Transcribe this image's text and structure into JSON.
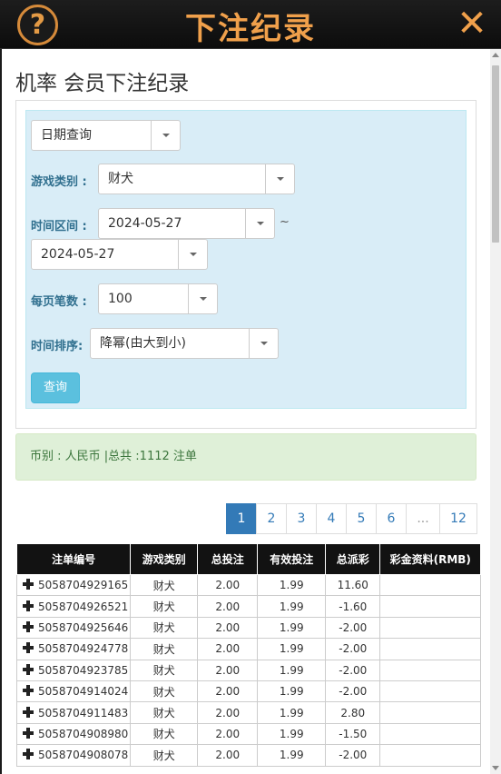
{
  "header": {
    "title": "下注纪录",
    "help_glyph": "?",
    "close_glyph": "✕"
  },
  "page_title": "机率 会员下注纪录",
  "filters": {
    "query_mode": "日期查询",
    "game_type_label": "游戏类别 :",
    "game_type_value": "财犬",
    "time_range_label": "时间区间 :",
    "date_start": "2024-05-27",
    "range_separator": "~",
    "date_end": "2024-05-27",
    "per_page_label": "每页笔数 :",
    "per_page_value": "100",
    "sort_label": "时间排序:",
    "sort_value": "降幂(由大到小)",
    "query_button": "查询"
  },
  "summary": "币别 : 人民币 |总共 :1112 注单",
  "pagination": {
    "pages": [
      "1",
      "2",
      "3",
      "4",
      "5",
      "6",
      "...",
      "12"
    ],
    "active": "1"
  },
  "table": {
    "headers": [
      "注单编号",
      "游戏类别",
      "总投注",
      "有效投注",
      "总派彩",
      "彩金资料(RMB)"
    ],
    "rows": [
      {
        "id": "5058704929165",
        "game": "财犬",
        "bet": "2.00",
        "valid": "1.99",
        "payout": "11.60",
        "jackpot": ""
      },
      {
        "id": "5058704926521",
        "game": "财犬",
        "bet": "2.00",
        "valid": "1.99",
        "payout": "-1.60",
        "jackpot": ""
      },
      {
        "id": "5058704925646",
        "game": "财犬",
        "bet": "2.00",
        "valid": "1.99",
        "payout": "-2.00",
        "jackpot": ""
      },
      {
        "id": "5058704924778",
        "game": "财犬",
        "bet": "2.00",
        "valid": "1.99",
        "payout": "-2.00",
        "jackpot": ""
      },
      {
        "id": "5058704923785",
        "game": "财犬",
        "bet": "2.00",
        "valid": "1.99",
        "payout": "-2.00",
        "jackpot": ""
      },
      {
        "id": "5058704914024",
        "game": "财犬",
        "bet": "2.00",
        "valid": "1.99",
        "payout": "-2.00",
        "jackpot": ""
      },
      {
        "id": "5058704911483",
        "game": "财犬",
        "bet": "2.00",
        "valid": "1.99",
        "payout": "2.80",
        "jackpot": ""
      },
      {
        "id": "5058704908980",
        "game": "财犬",
        "bet": "2.00",
        "valid": "1.99",
        "payout": "-1.50",
        "jackpot": ""
      },
      {
        "id": "5058704908078",
        "game": "财犬",
        "bet": "2.00",
        "valid": "1.99",
        "payout": "-2.00",
        "jackpot": ""
      }
    ]
  },
  "colors": {
    "accent_orange": "#f0a04b",
    "link_blue": "#337ab7",
    "negative_red": "#e00000",
    "header_black": "#121212"
  }
}
